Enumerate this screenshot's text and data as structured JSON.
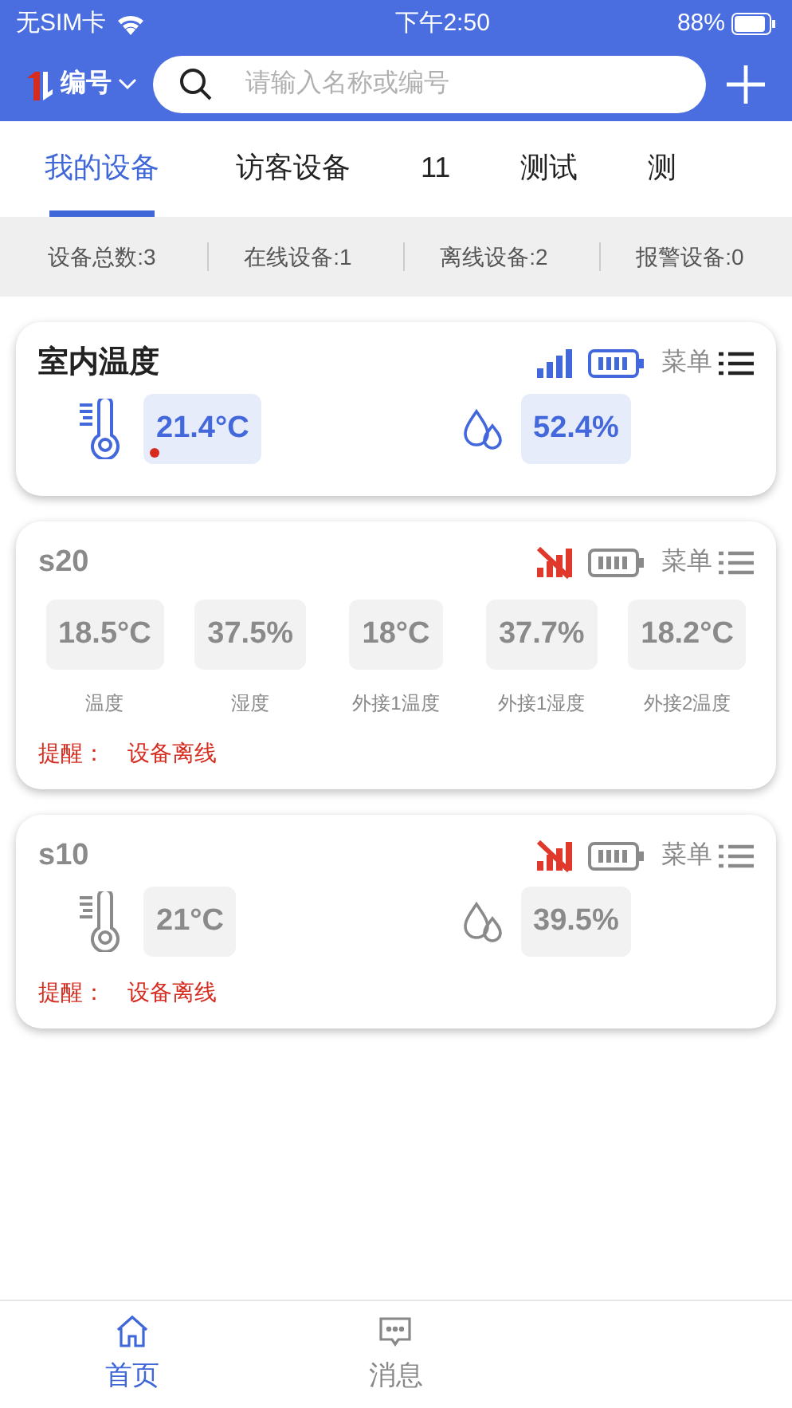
{
  "status_bar": {
    "carrier": "无SIM卡",
    "time": "下午2:50",
    "battery": "88%"
  },
  "header": {
    "selector": "编号",
    "search": {
      "placeholder": "请输入名称或编号"
    }
  },
  "tabs": [
    {
      "label": "我的设备",
      "selected": true
    },
    {
      "label": "访客设备",
      "selected": false
    },
    {
      "label": "11",
      "selected": false
    },
    {
      "label": "测试",
      "selected": false
    },
    {
      "label": "测",
      "selected": false
    }
  ],
  "stats": [
    "设备总数:3",
    "在线设备:1",
    "离线设备:2",
    "报警设备:0"
  ],
  "devices": [
    {
      "name": "室内温度",
      "online": true,
      "kind": "sensors",
      "menu": "菜单",
      "readings": [
        {
          "kind": "temperature",
          "value": "21.4°C",
          "alert": true
        },
        {
          "kind": "humidity",
          "value": "52.4%",
          "alert": false
        }
      ]
    },
    {
      "name": "s20",
      "online": false,
      "kind": "grid",
      "menu": "菜单",
      "readings": [
        {
          "value": "18.5°C",
          "label": "温度"
        },
        {
          "value": "37.5%",
          "label": "湿度"
        },
        {
          "value": "18°C",
          "label": "外接1温度"
        },
        {
          "value": "37.7%",
          "label": "外接1湿度"
        },
        {
          "value": "18.2°C",
          "label": "外接2温度"
        }
      ],
      "reminder": {
        "label": "提醒：",
        "text": "设备离线"
      }
    },
    {
      "name": "s10",
      "online": false,
      "kind": "sensors",
      "menu": "菜单",
      "readings": [
        {
          "kind": "temperature",
          "value": "21°C",
          "alert": false
        },
        {
          "kind": "humidity",
          "value": "39.5%",
          "alert": false
        }
      ],
      "reminder": {
        "label": "提醒：",
        "text": "设备离线"
      }
    }
  ],
  "bottom_nav": [
    {
      "label": "首页",
      "kind": "home",
      "selected": true
    },
    {
      "label": "消息",
      "kind": "message",
      "selected": false
    }
  ]
}
